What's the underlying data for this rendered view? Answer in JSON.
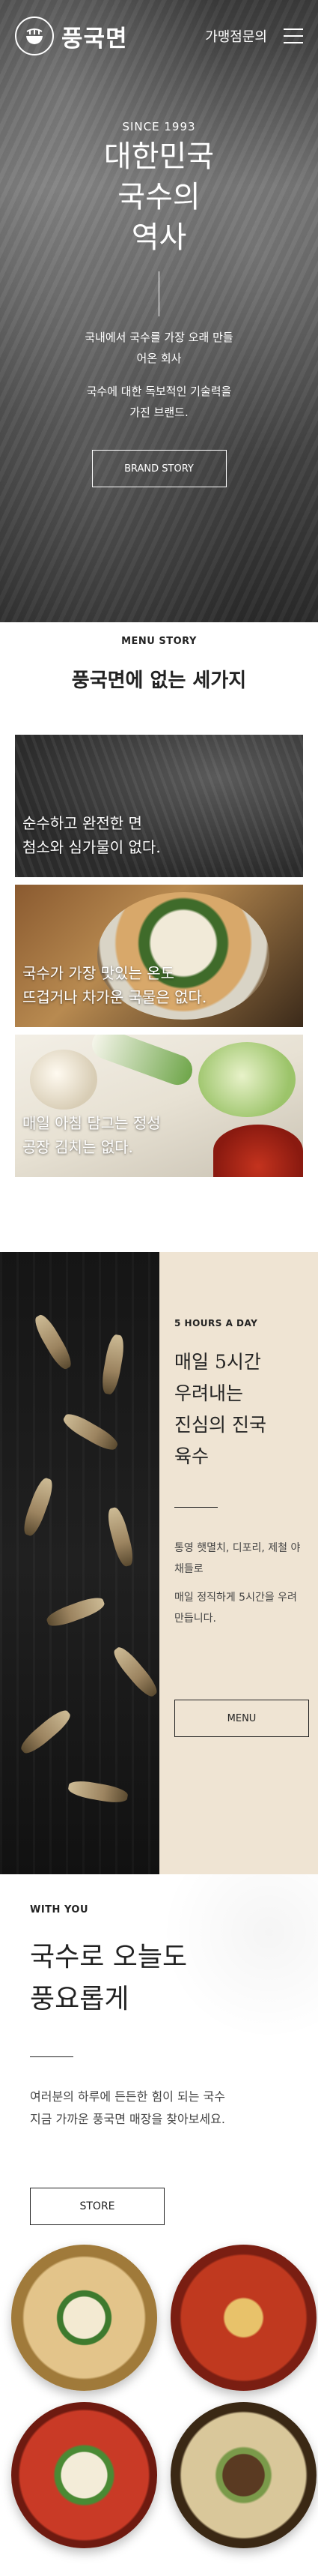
{
  "header": {
    "logo_text": "풍국면",
    "franchise_link": "가맹점문의"
  },
  "hero": {
    "since": "SINCE 1993",
    "title_lines": [
      "대한민국",
      "국수의",
      "역사"
    ],
    "desc_1": "국내에서 국수를 가장 오래 만들어온 회사",
    "desc_2": "국수에 대한 독보적인 기술력을 가진 브랜드.",
    "button": "BRAND STORY"
  },
  "menu_story": {
    "eyebrow": "MENU STORY",
    "title": "풍국면에 없는 세가지",
    "cards": [
      {
        "line1": "순수하고 완전한 면",
        "line2": "첨소와 심가물이 없다."
      },
      {
        "line1": "국수가 가장 맛있는 온도",
        "line2": "뜨겁거나 차가운 국물은 없다."
      },
      {
        "line1": "매일 아침 담그는 정성",
        "line2": "공장 김치는 없다."
      }
    ]
  },
  "five_hours": {
    "eyebrow": "5 HOURS A DAY",
    "title_lines": [
      "매일 5시간",
      "우려내는",
      "진심의 진국",
      "육수"
    ],
    "desc_1": "통영 햇멸치, 디포리, 제철 야채들로",
    "desc_2": "매일 정직하게 5시간을 우려 만듭니다.",
    "button": "MENU"
  },
  "with_you": {
    "eyebrow": "WITH YOU",
    "title_lines": [
      "국수로 오늘도",
      "풍요롭게"
    ],
    "desc_1": "여러분의 하루에 든든한 힘이 되는 국수",
    "desc_2": "지금 가까운 풍국면 매장을 찾아보세요.",
    "button": "STORE"
  },
  "colors": {
    "cream": "#efe4d3",
    "text_dark": "#222222",
    "white": "#ffffff"
  },
  "icons": [
    "logo-bowl-icon",
    "hamburger-menu-icon"
  ]
}
